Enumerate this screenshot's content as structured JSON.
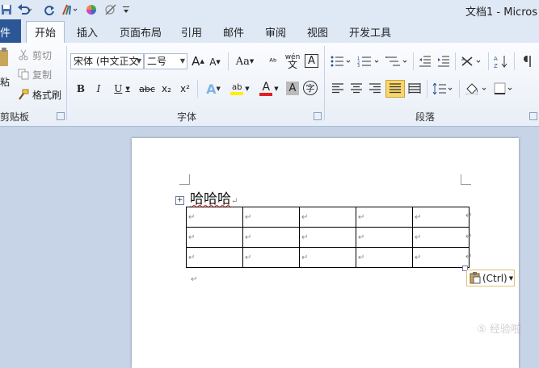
{
  "window": {
    "title": "文档1 - Micros"
  },
  "quick_access": {
    "icons": [
      "save-icon",
      "undo-icon",
      "redo-icon",
      "format-painter-icon",
      "color-wheel-icon",
      "clear-format-icon",
      "customize-icon"
    ]
  },
  "tabs": [
    {
      "label": "件",
      "active": false
    },
    {
      "label": "开始",
      "active": true
    },
    {
      "label": "插入",
      "active": false
    },
    {
      "label": "页面布局",
      "active": false
    },
    {
      "label": "引用",
      "active": false
    },
    {
      "label": "邮件",
      "active": false
    },
    {
      "label": "审阅",
      "active": false
    },
    {
      "label": "视图",
      "active": false
    },
    {
      "label": "开发工具",
      "active": false
    }
  ],
  "clipboard": {
    "paste_label": "粘",
    "cut_label": "剪切",
    "copy_label": "复制",
    "painter_label": "格式刷",
    "group_label": "剪贴板"
  },
  "font": {
    "font_name": "宋体 (中文正文",
    "font_size": "二号",
    "group_label": "字体",
    "bold": "B",
    "italic": "I",
    "underline": "U",
    "strike": "abc",
    "subscript": "x₂",
    "superscript": "x²",
    "grow": "A",
    "shrink": "A",
    "case": "Aa",
    "clear": "ᴬᵇ",
    "phonetic": "wén",
    "char_border": "A",
    "text_effect": "A",
    "highlight": "ab",
    "font_color": "A",
    "char_shading": "A",
    "enclose": "字"
  },
  "paragraph": {
    "group_label": "段落"
  },
  "document": {
    "heading_text": "哈哈哈",
    "paragraph_mark": "↵",
    "table": [
      [
        "↵",
        "↵",
        "↵",
        "↵",
        "↵"
      ],
      [
        "↵",
        "↵",
        "↵",
        "↵",
        "↵"
      ],
      [
        "↵",
        "↵",
        "↵",
        "↵",
        "↵"
      ]
    ],
    "paste_options_label": "(Ctrl)"
  },
  "watermark": "⑤ 经验啦",
  "colors": {
    "file_tab": "#2b5797",
    "ribbon_border": "#a9bbd6",
    "highlight_btn": "#f8d66b",
    "font_red": "#e02020",
    "highlight_yellow": "#ffee00"
  }
}
